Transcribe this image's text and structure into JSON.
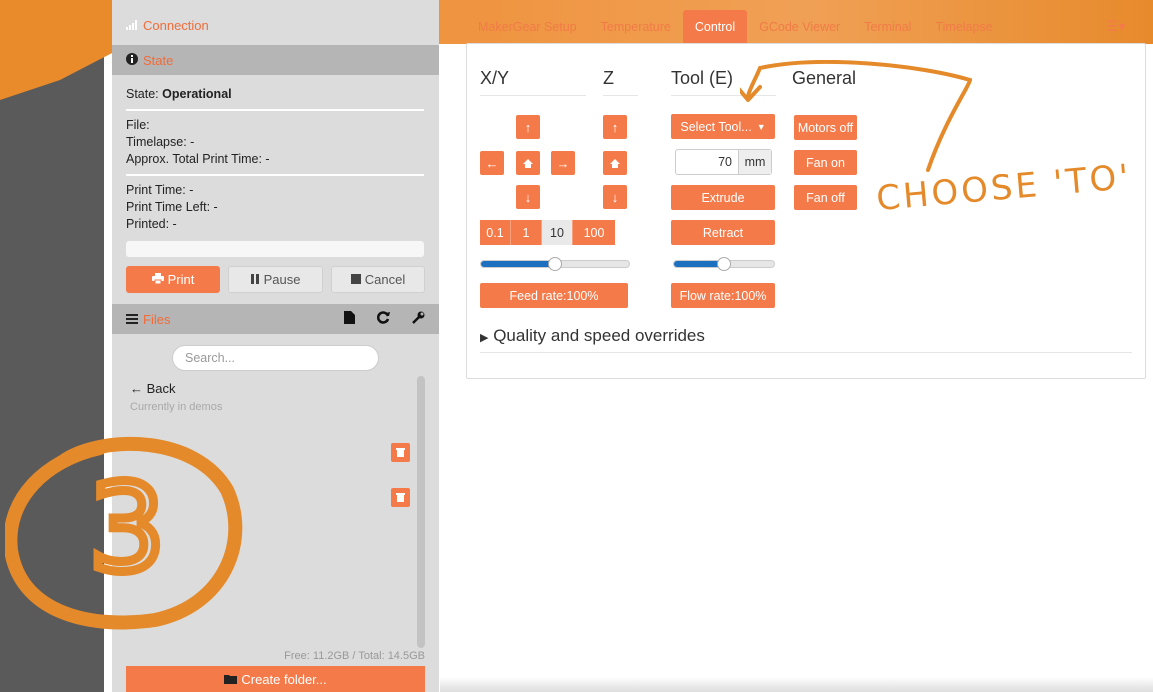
{
  "connection": {
    "label": "Connection"
  },
  "state_panel": {
    "title": "State",
    "state_label": "State:",
    "state_value": "Operational",
    "file_label": "File:",
    "timelapse": "Timelapse: -",
    "approx_time": "Approx. Total Print Time: -",
    "print_time": "Print Time: -",
    "print_time_left": "Print Time Left: -",
    "printed": "Printed: -",
    "print_button": "Print",
    "pause_button": "Pause",
    "cancel_button": "Cancel"
  },
  "files_panel": {
    "title": "Files",
    "search_placeholder": "Search...",
    "back_label": "Back",
    "current_folder": "Currently in demos",
    "free_space": "Free: 11.2GB / Total: 14.5GB",
    "create_folder": "Create folder..."
  },
  "annotation_number": "3",
  "tabs": [
    {
      "label": "MakerGear Setup",
      "active": false
    },
    {
      "label": "Temperature",
      "active": false
    },
    {
      "label": "Control",
      "active": true
    },
    {
      "label": "GCode Viewer",
      "active": false
    },
    {
      "label": "Terminal",
      "active": false
    },
    {
      "label": "Timelapse",
      "active": false
    }
  ],
  "control": {
    "xy_header": "X/Y",
    "z_header": "Z",
    "tool_header": "Tool (E)",
    "general_header": "General",
    "step_values": [
      "0.1",
      "1",
      "10",
      "100"
    ],
    "selected_step": "10",
    "feed_rate_button": "Feed rate:100%",
    "flow_rate_button": "Flow rate:100%",
    "feed_rate_fraction": 0.5,
    "flow_rate_fraction": 0.5,
    "select_tool": "Select Tool...",
    "extrude_amount": "70",
    "extrude_unit": "mm",
    "extrude_button": "Extrude",
    "retract_button": "Retract",
    "motors_off": "Motors off",
    "fan_on": "Fan on",
    "fan_off": "Fan off",
    "quality_overrides": "Quality and speed overrides"
  },
  "annotation_text": "CHOOSE 'TO'",
  "colors": {
    "accent": "#f47a4a",
    "brand_orange": "#e58a2a",
    "slider_blue": "#1d6fc0"
  }
}
